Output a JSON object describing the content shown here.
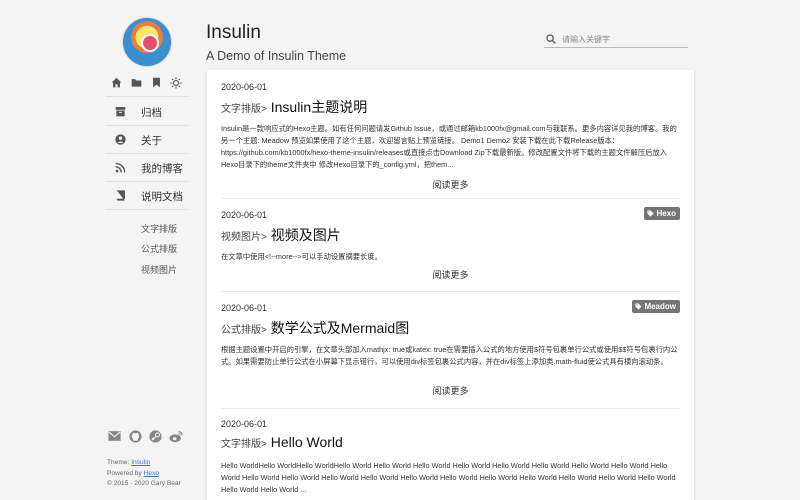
{
  "site": {
    "title": "Insulin",
    "subtitle": "A Demo of Insulin Theme"
  },
  "search": {
    "placeholder": "请输入关键字"
  },
  "sidebar": {
    "icons": [
      "home-icon",
      "folder-icon",
      "bookmark-icon",
      "theme-toggle-icon"
    ],
    "nav": [
      {
        "label": "归档",
        "icon": "archive-icon"
      },
      {
        "label": "关于",
        "icon": "user-icon"
      },
      {
        "label": "我的博客",
        "icon": "rss-icon"
      },
      {
        "label": "说明文档",
        "icon": "book-icon"
      }
    ],
    "sub_items": [
      "文字排版",
      "公式排版",
      "视频图片"
    ],
    "social": [
      "mail-icon",
      "github-icon",
      "steam-icon",
      "weibo-icon"
    ],
    "footer": {
      "theme_prefix": "Theme: ",
      "theme_link": "Insulin",
      "powered_prefix": "Powered by ",
      "powered_link": "Hexo",
      "copyright": "© 2015 - 2020 Gary Bear"
    }
  },
  "posts": [
    {
      "date": "2020-06-01",
      "category": "文字排版>",
      "title": " Insulin主题说明",
      "excerpt": "Insulin是一款响应式的Hexo主题。如有任何问题请发Github Issue，或通过邮箱kb1000fx@gmail.com与我联系。更多内容详见我的博客。我的另一个主题: Meadow 预览如果使用了这个主题，欢迎留言贴上预览链接。 Demo1 Demo2 安装下载在此下载Release版本：https://github.com/kb1000fx/hexo-theme-insulin/releases或直接点击Download Zip下载最新版。修改配置文件将下载的主题文件解压后放入Hexo目录下的theme文件夹中 修改Hexo目录下的_config.yml，把them...",
      "read_more": "阅读更多",
      "tag": ""
    },
    {
      "date": "2020-06-01",
      "category": "视频图片>",
      "title": " 视频及图片",
      "excerpt": "在文章中使用<!--more-->可以手动设置摘要长度。",
      "read_more": "阅读更多",
      "tag": "Hexo"
    },
    {
      "date": "2020-06-01",
      "category": "公式排版>",
      "title": " 数学公式及Mermaid图",
      "excerpt": "根据主题设置中开启的引擎，在文章头部加入mathjx: true或katex: true在需要插入公式的地方使用$符号包裹单行公式或使用$$符号包裹行内公式。如果需要防止单行公式在小屏幕下显示错行，可以使用div标签包裹公式内容，并在div标签上添加类.math-fluid使公式具有横向滚动条。",
      "read_more": "阅读更多",
      "tag": "Meadow"
    },
    {
      "date": "2020-06-01",
      "category": "文字排版>",
      "title": " Hello World",
      "excerpt": "Hello WorldHello WorldHello WorldHello World Hello World Hello World Hello World Hello World Hello World Hello World Hello World Hello World Hello World Hello World Hello World Hello World Hello World Hello World Hello World Hello World Hello World Hello World Hello World Hello World Hello World ...",
      "read_more": "",
      "tag": ""
    }
  ],
  "colors": {
    "tag_bg": "#757575",
    "link": "#3b78c4",
    "background": "#f4f4f4"
  }
}
